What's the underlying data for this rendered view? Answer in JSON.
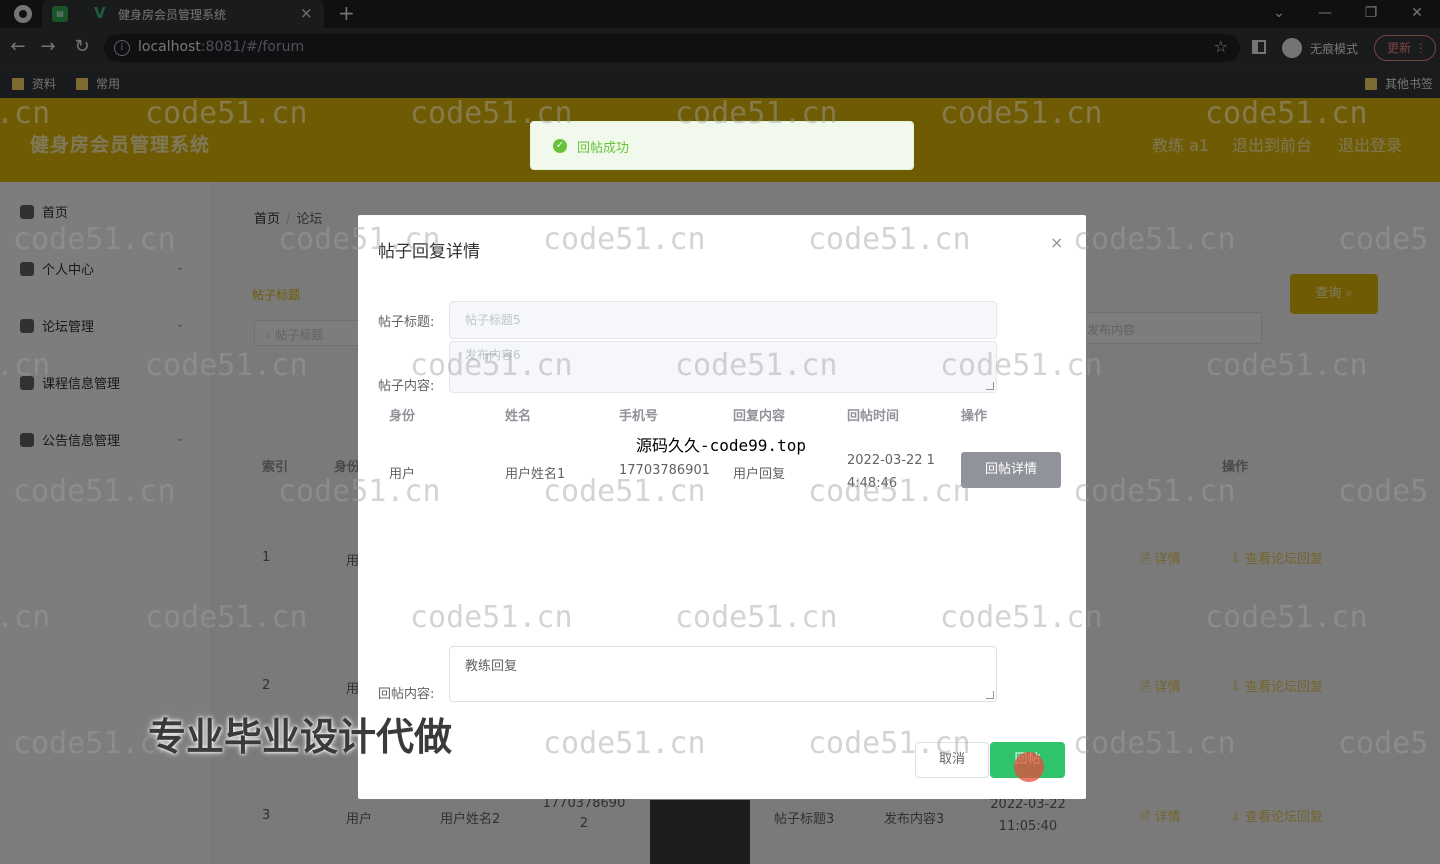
{
  "browser": {
    "tab_title": "健身房会员管理系统",
    "tab_close": "×",
    "new_tab": "+",
    "url_host": "localhost",
    "url_rest": ":8081/#/forum",
    "incognito_label": "无痕模式",
    "update_label": "更新",
    "bookmarks": [
      "资料",
      "常用"
    ],
    "other_bookmarks": "其他书签"
  },
  "header": {
    "brand": "健身房会员管理系统",
    "user": "教练 a1",
    "back_to_front": "退出到前台",
    "logout": "退出登录"
  },
  "sidebar": {
    "items": [
      {
        "label": "首页"
      },
      {
        "label": "个人中心"
      },
      {
        "label": "论坛管理"
      },
      {
        "label": "课程信息管理"
      },
      {
        "label": "公告信息管理"
      }
    ]
  },
  "main": {
    "breadcrumb_home": "首页",
    "breadcrumb_sep": "/",
    "breadcrumb_current": "论坛",
    "search_label": "帖子标题",
    "search_placeholder": "帖子标题",
    "search_placeholder_2": "发布内容",
    "query_button": "查询",
    "columns": [
      "索引",
      "身份",
      "操作"
    ],
    "rows": [
      {
        "index": "1",
        "identity": "用",
        "detail": "详情",
        "view": "查看论坛回复"
      },
      {
        "index": "2",
        "identity": "用",
        "detail": "详情",
        "view": "查看论坛回复"
      },
      {
        "index": "3",
        "identity": "用户",
        "name": "用户姓名2",
        "phone": "17703786902",
        "title": "帖子标题3",
        "content": "发布内容3",
        "time": "2022-03-22 11:05:40",
        "detail": "详情",
        "view": "查看论坛回复"
      }
    ]
  },
  "toast": {
    "message": "回帖成功"
  },
  "dialog": {
    "title": "帖子回复详情",
    "close": "×",
    "title_label": "帖子标题:",
    "title_value": "帖子标题5",
    "content_label": "帖子内容:",
    "content_value": "发布内容6",
    "columns": [
      "身份",
      "姓名",
      "手机号",
      "回复内容",
      "回帖时间",
      "操作"
    ],
    "reply": {
      "identity": "用户",
      "name": "用户姓名1",
      "phone": "17703786901",
      "content": "用户回复",
      "time": "2022-03-22 14:48:46",
      "action": "回帖详情"
    },
    "reply_label": "回帖内容:",
    "reply_value": "教练回复",
    "cancel": "取消",
    "submit": "回帖"
  },
  "overlay_text": {
    "watermark": "code51.cn",
    "mid_banner": "源码久久-code99.top",
    "promo": "专业毕业设计代做"
  },
  "colors": {
    "accent": "#e1b60a",
    "success": "#67c23a",
    "submit": "#2fc46b"
  }
}
